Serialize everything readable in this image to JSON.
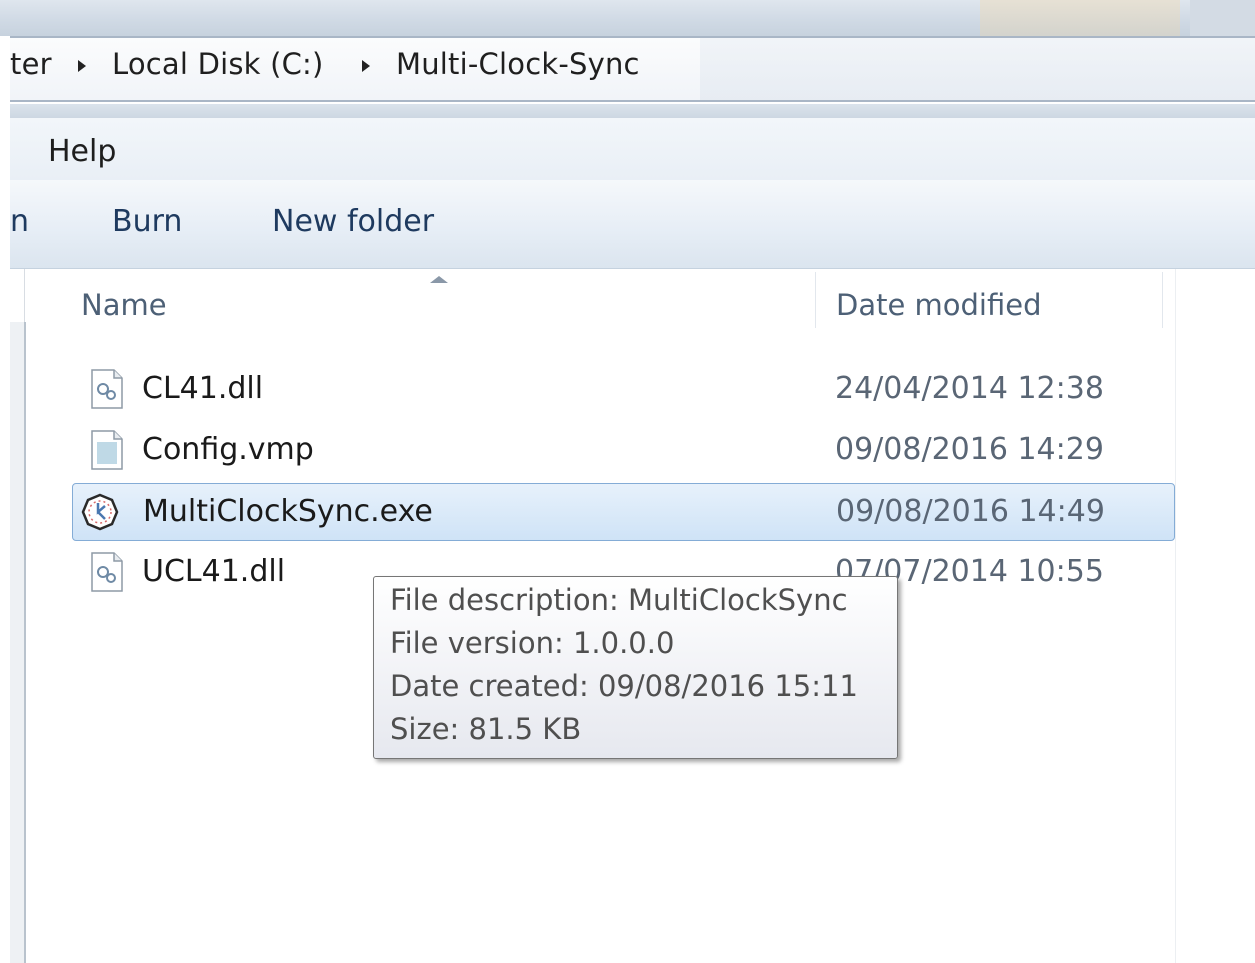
{
  "address_bar": {
    "crumbs": [
      "ter",
      "Local Disk (C:)",
      "Multi-Clock-Sync"
    ]
  },
  "menu": {
    "items": [
      "Help"
    ]
  },
  "toolbar": {
    "partial_label": "n",
    "burn_label": "Burn",
    "new_folder_label": "New folder"
  },
  "file_list": {
    "columns": [
      "Name",
      "Date modified"
    ],
    "rows": [
      {
        "name": "CL41.dll",
        "date": "24/04/2014 12:38",
        "icon": "dll-file-icon"
      },
      {
        "name": "Config.vmp",
        "date": "09/08/2016 14:29",
        "icon": "generic-file-icon"
      },
      {
        "name": "MultiClockSync.exe",
        "date": "09/08/2016 14:49",
        "icon": "clock-app-icon",
        "selected": true
      },
      {
        "name": "UCL41.dll",
        "date": "07/07/2014 10:55",
        "icon": "dll-file-icon"
      }
    ]
  },
  "tooltip": {
    "description": "File description: MultiClockSync",
    "version": "File version: 1.0.0.0",
    "created": "Date created: 09/08/2016 15:11",
    "size": "Size: 81.5 KB"
  },
  "colors": {
    "selection": "#cfe3f7",
    "selection_border": "#84acd6",
    "header_text": "#4d6076"
  }
}
